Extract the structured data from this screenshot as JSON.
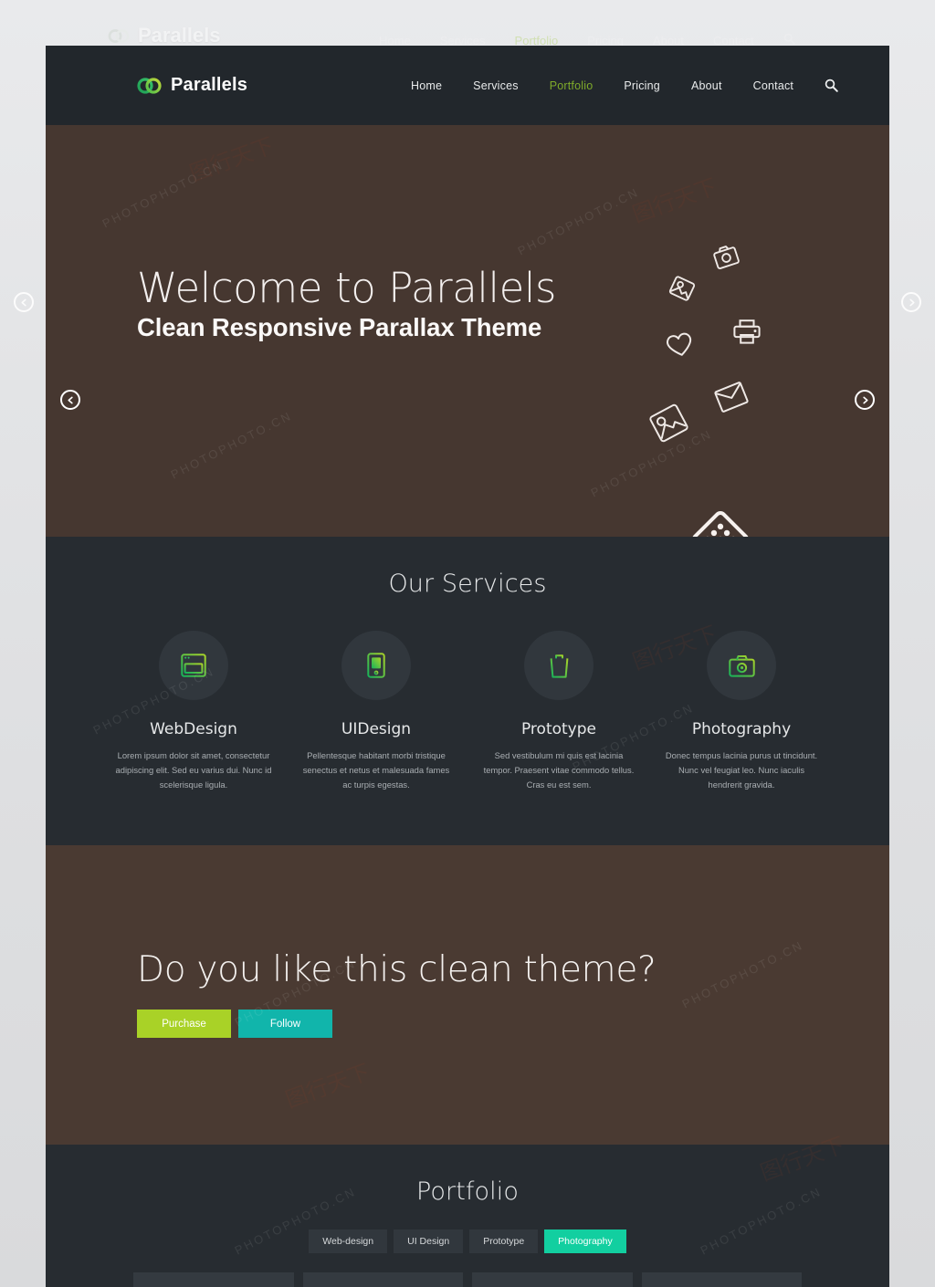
{
  "brand": {
    "name": "Parallels",
    "logo_icon": "interlocking-rings-icon",
    "logo_color": "#4caf50"
  },
  "nav": {
    "items": [
      {
        "label": "Home",
        "active": false
      },
      {
        "label": "Services",
        "active": false
      },
      {
        "label": "Portfolio",
        "active": true
      },
      {
        "label": "Pricing",
        "active": false
      },
      {
        "label": "About",
        "active": false
      },
      {
        "label": "Contact",
        "active": false
      }
    ],
    "search_icon": "search-icon",
    "active_color": "#7fab2a"
  },
  "hero": {
    "title": "Welcome to Parallels",
    "subtitle": "Clean Responsive Parallax Theme",
    "background_color": "#463730",
    "prev_icon": "arrow-left-circle-icon",
    "next_icon": "arrow-right-circle-icon",
    "decor_icons": [
      "camera-icon",
      "photo-icon",
      "printer-icon",
      "heart-icon",
      "envelope-icon",
      "image-pin-icon",
      "grid-diamond-icon",
      "sun-icon"
    ]
  },
  "services": {
    "title": "Our Services",
    "items": [
      {
        "icon": "browser-window-icon",
        "name": "WebDesign",
        "desc": "Lorem ipsum dolor sit amet, consectetur adipiscing elit. Sed eu varius dui. Nunc id scelerisque ligula."
      },
      {
        "icon": "mobile-device-icon",
        "name": "UIDesign",
        "desc": "Pellentesque habitant morbi tristique senectus et netus et malesuada fames ac turpis egestas."
      },
      {
        "icon": "trash-bin-icon",
        "name": "Prototype",
        "desc": "Sed vestibulum mi quis est lacinia tempor. Praesent vitae commodo tellus. Cras eu est sem."
      },
      {
        "icon": "camera-icon",
        "name": "Photography",
        "desc": "Donec tempus lacinia purus ut tincidunt. Nunc vel feugiat leo. Nunc iaculis hendrerit gravida."
      }
    ]
  },
  "cta": {
    "title": "Do you like this clean theme?",
    "purchase_label": "Purchase",
    "follow_label": "Follow",
    "purchase_color": "#a9d227",
    "follow_color": "#11b5ab",
    "background_color": "#4a3a32"
  },
  "portfolio": {
    "title": "Portfolio",
    "filters": [
      {
        "label": "Web-design",
        "active": false
      },
      {
        "label": "UI Design",
        "active": false
      },
      {
        "label": "Prototype",
        "active": false
      },
      {
        "label": "Photography",
        "active": true
      }
    ],
    "active_color": "#12cfa0"
  },
  "watermark": {
    "text": "PHOTOPHOTO.CN",
    "short": "图行天下"
  }
}
